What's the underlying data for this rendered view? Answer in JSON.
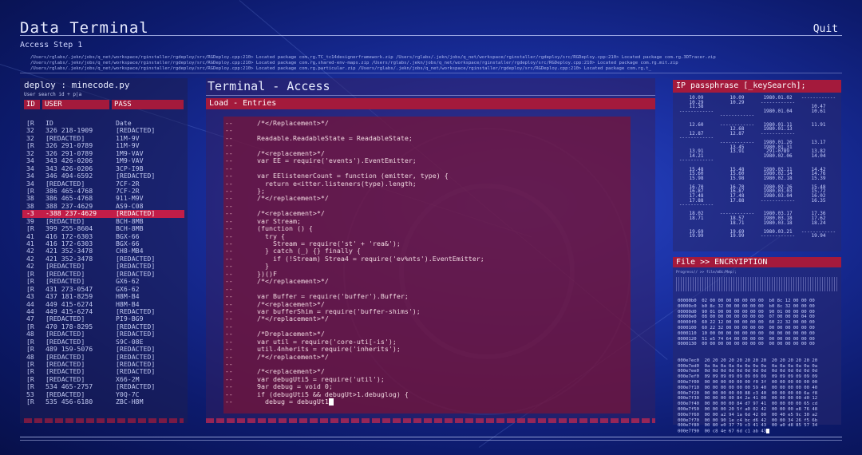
{
  "app": {
    "title": "Data Terminal",
    "quit_label": "Quit",
    "subtitle": "Access Step 1"
  },
  "paths": [
    "/Users/rglabs/.jekn/jobs/q_net/workspace/rginstaller/rgdeploy/src/RGDeploy.cpp:210> Located package com.rg.TC_tc14designerframework.zip /Users/rglabs/.jekn/jobs/q_net/workspace/rginstaller/rgdeploy/src/RGDeploy.cpp:210> Located package com.rg.3DTracer.zip",
    "/Users/rglabs/.jekn/jobs/q_net/workspace/rginstaller/rgdeploy/src/RGDeploy.cpp:210> Located package com.rg.shared-env-maps.zip /Users/rglabs/.jekn/jobs/q_net/workspace/rginstaller/rgdeploy/src/RGDeploy.cpp:210> Located package com.rg.mit.zip",
    "/Users/rglabs/.jekn/jobs/q_net/workspace/rginstaller/rgdeploy/src/RGDeploy.cpp:210> Located package com.rg.particular.zip /Users/rglabs/.jekn/jobs/q_net/workspace/rginstaller/rgdeploy/src/RGDeploy.cpp:210> Located package com.rg.t_"
  ],
  "left_panel": {
    "deploy": "deploy : minecode.py",
    "search": "User search id + p|a",
    "columns": [
      "ID",
      "USER",
      "PASS"
    ],
    "rows": [
      [
        "[R",
        "ID",
        "Date"
      ],
      [
        "32",
        "326 218-1909",
        "[REDACTED]"
      ],
      [
        "32",
        "[REDACTED]",
        "11M-9V"
      ],
      [
        "[R",
        "326 291-0789",
        "11M-9V"
      ],
      [
        "32",
        "326 291-0789",
        "1M9-VAV"
      ],
      [
        "34",
        "343 426-0206",
        "1M9-VAV"
      ],
      [
        "34",
        "343 426-0206",
        "3CP-I9B"
      ],
      [
        "34",
        "346 494-6592",
        "[REDACTED]"
      ],
      [
        "34",
        "[REDACTED]",
        "7CF-2R"
      ],
      [
        "[R",
        "386 465-4768",
        "7CF-2R"
      ],
      [
        "38",
        "386 465-4768",
        "911-M9V"
      ],
      [
        "38",
        "388 237-4629",
        "AS9-C08"
      ],
      [
        "-3",
        "-388 237-4629",
        "[REDACTED]"
      ],
      [
        "39",
        "[REDACTED]",
        "BCH-8MB"
      ],
      [
        "[R",
        "399 255-8604",
        "BCH-8MB"
      ],
      [
        "41",
        "416 172-6303",
        "BGX-66"
      ],
      [
        "41",
        "416 172-6303",
        "BGX-66"
      ],
      [
        "42",
        "421 352-3478",
        "CH8-MB4"
      ],
      [
        "42",
        "421 352-3478",
        "[REDACTED]"
      ],
      [
        "42",
        "[REDACTED]",
        "[REDACTED]"
      ],
      [
        "[R",
        "[REDACTED]",
        "[REDACTED]"
      ],
      [
        "[R",
        "[REDACTED]",
        "GX6-62"
      ],
      [
        "[R",
        "431 273-0547",
        "GX6-62"
      ],
      [
        "43",
        "437 181-8259",
        "H8M-B4"
      ],
      [
        "44",
        "449 415-6274",
        "H8M-B4"
      ],
      [
        "44",
        "449 415-6274",
        "[REDACTED]"
      ],
      [
        "47",
        "[REDACTED]",
        "PI9-BG9"
      ],
      [
        "[R",
        "470 178-8295",
        "[REDACTED]"
      ],
      [
        "48",
        "[REDACTED]",
        "[REDACTED]"
      ],
      [
        "[R",
        "[REDACTED]",
        "S9C-08E"
      ],
      [
        "[R",
        "489 159-5076",
        "[REDACTED]"
      ],
      [
        "48",
        "[REDACTED]",
        "[REDACTED]"
      ],
      [
        "[R",
        "[REDACTED]",
        "[REDACTED]"
      ],
      [
        "[R",
        "[REDACTED]",
        "[REDACTED]"
      ],
      [
        "[R",
        "[REDACTED]",
        "X66-2M"
      ],
      [
        "[R",
        "534 465-2757",
        "[REDACTED]"
      ],
      [
        "53",
        "[REDACTED]",
        "Y0Q-7C"
      ],
      [
        "[R",
        "535 456-6180",
        "ZBC-H8M"
      ]
    ],
    "selected_row": 12
  },
  "terminal": {
    "title": "Terminal - Access",
    "load_label": "Load - Entries",
    "gutter": "--",
    "code": [
      "/*</Replacement>*/",
      "",
      "Readable.ReadableState = ReadableState;",
      "",
      "/*<replacement>*/",
      "var EE = require('events').EventEmitter;",
      "",
      "var EElistenerCount = function (emitter, type) {",
      "  return e<itter.listeners(type).length;",
      "};",
      "/*</replacement>*/",
      "",
      "/*<replacement>*/",
      "var Stream;",
      "(function () {",
      "  try {",
      "    Stream = require('st' + 'rea&');",
      "  } catch (_) {} finally {",
      "    if (!Stream) Strea4 = require('ev%nts').EventEmitter;",
      "  }",
      "})()F",
      "/*</replacement>*/",
      "",
      "var Buffer = require('buffer').Buffer;",
      "/*<replacement>*/",
      "var bufferShim = require('buffer-shims');",
      "/*</replacement>*/",
      "",
      "/*Dreplacement>*/",
      "var util = require('core-uti[-is');",
      "util.4nherits = require('inherits');",
      "/*</replacement>*/",
      "",
      "/*<replacement>*/",
      "var debugUti5 = require('util');",
      "9ar debug = void 0;",
      "if (debugUti5 && debugUt>1.debuglog) {",
      "  debug = debugUt1"
    ]
  },
  "ip_panel": {
    "title": "IP passphrase [_keySearch];",
    "rows": [
      [
        "10.09",
        "10.09",
        "1980.01.02",
        "------------"
      ],
      [
        "10.29",
        "10.29",
        "------------",
        ""
      ],
      [
        "11.38",
        "",
        "",
        "10.47"
      ],
      [
        "------------",
        "",
        "1980.01.04",
        "10.61"
      ],
      [
        "",
        "------------",
        "",
        ""
      ],
      [
        "",
        "",
        "",
        ""
      ],
      [
        "12.60",
        "------------",
        "1980.01.11",
        "11.91"
      ],
      [
        "",
        "12.68",
        "1980.01.13",
        ""
      ],
      [
        "12.87",
        "12.87",
        "------------",
        ""
      ],
      [
        "------------",
        "",
        "",
        ""
      ],
      [
        "",
        "------------",
        "1980.01.26",
        "13.17"
      ],
      [
        "",
        "13.45",
        "1980.01.31",
        ""
      ],
      [
        "13.91",
        "13.91",
        "291-0789",
        "13.82"
      ],
      [
        "14.21",
        "",
        "1980.02.06",
        "14.04"
      ],
      [
        "------------",
        "",
        "",
        ""
      ],
      [
        "",
        "",
        "",
        ""
      ],
      [
        "15.48",
        "15.48",
        "1980.02.11",
        "14.42"
      ],
      [
        "15.60",
        "15.60",
        "1980.02.14",
        "14.76"
      ],
      [
        "15.98",
        "15.98",
        "1980.02.18",
        "15.39"
      ],
      [
        "",
        "",
        "",
        ""
      ],
      [
        "16.70",
        "16.70",
        "1980.02.26",
        "15.48"
      ],
      [
        "16.87",
        "16.87",
        "1980.03.03",
        "15.72"
      ],
      [
        "17.48",
        "17.48",
        "1980.03.04",
        "16.02"
      ],
      [
        "17.88",
        "17.88",
        "------------",
        "16.35"
      ],
      [
        "------------",
        "",
        "",
        ""
      ],
      [
        "",
        "",
        "",
        ""
      ],
      [
        "18.02",
        "------------",
        "1980.03.17",
        "17.36"
      ],
      [
        "18.71",
        "18.57",
        "1980.03.18",
        "17.62"
      ],
      [
        "",
        "18.71",
        "1980.03.18",
        "18.24"
      ],
      [
        "",
        "",
        "",
        ""
      ],
      [
        "19.69",
        "19.69",
        "1980.03.21",
        "------------"
      ],
      [
        "19.99",
        "19.99",
        "------------",
        "19.94"
      ]
    ]
  },
  "file_panel": {
    "title": "File >> ENCRYIPTION",
    "progress": "Progress// >> file/mBc/Mep/;",
    "hex_rows": [
      "00000b0  02 00 00 00 00 00 00 00  b0 8c 12 00 00 00",
      "00000c0  b0 8c 32 00 00 00 00 00  b0 8c 32 00 00 00",
      "00000d0  90 01 00 00 00 00 00 00  90 01 00 00 00 00",
      "00000e0  08 00 00 00 00 00 00 00  07 00 00 00 04 00",
      "00000f0  60 22 12 00 00 00 00 00  60 22 32 00 00 00",
      "0000100  60 22 32 00 00 00 00 00  00 00 00 00 00 00",
      "0000110  10 00 00 00 00 00 00 00  08 00 00 00 00 00",
      "0000120  51 e5 74 64 00 00 00 00  00 00 00 00 00 00",
      "0000130  00 00 00 00 00 00 00 00  00 00 00 00 00 00",
      "",
      "",
      "000e7ec0  20 20 20 20 20 20 20 20  20 20 20 20 20 20",
      "000e7ed0  0a 0a 0a 0a 0a 0a 0a 0a  0a 0a 0a 0a 0a 0a",
      "000e7ee0  0d 0d 0d 0d 0d 0d 0d 0d  0d 0d 0d 0d 0d 0d",
      "000e7ef0  09 09 09 09 09 09 09 09  09 09 09 09 09 09",
      "000e7f00  00 00 00 00 00 00 f0 3f  00 00 00 00 00 00",
      "000e7f10  00 00 00 00 00 00 59 40  00 00 00 00 00 40",
      "000e7f20  00 00 00 00 00 88 c3 40  00 00 00 00 6a f8",
      "000e7f30  00 00 00 00 84 2e 41 00  00 00 00 00 d0 12",
      "000e7f40  00 00 00 00 84 d7 97 41  00 00 00 00 65 cd",
      "000e7f50  00 00 00 20 5f a0 02 42  00 00 00 e8 76 48",
      "000e7f60  00 00 a2 94 1a 6d 42 00  00 40 e5 9c 30 a2",
      "000e7f70  00 00 90 1e c4 bc d6 42  00 00 34 26 f5 6b",
      "000e7f80  00 80 e0 37 79 c3 41 43  00 a0 d8 85 57 34",
      "000e7f90  00 c8 4e 67 6d c1 ab 43"
    ]
  }
}
